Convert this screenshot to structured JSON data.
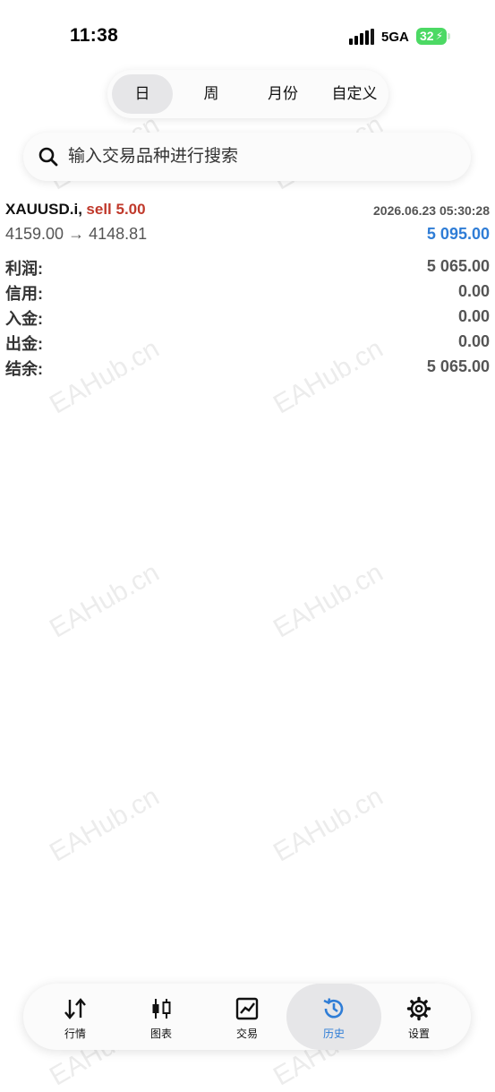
{
  "status_bar": {
    "time": "11:38",
    "network": "5GA",
    "battery": "32",
    "icons": [
      "signal-icon",
      "battery-icon"
    ]
  },
  "period_tabs": {
    "items": [
      "日",
      "周",
      "月份",
      "自定义"
    ],
    "active": "日"
  },
  "search": {
    "placeholder": "输入交易品种进行搜索",
    "icon": "search-icon"
  },
  "deal": {
    "symbol": "XAUUSD.i,",
    "side": "sell 5.00",
    "time": "2026.06.23 05:30:28",
    "prices": "4159.00 → 4148.81",
    "profit": "5 095.00"
  },
  "summary": [
    {
      "label": "利润:",
      "value": "5 065.00"
    },
    {
      "label": "信用:",
      "value": "0.00"
    },
    {
      "label": "入金:",
      "value": "0.00"
    },
    {
      "label": "出金:",
      "value": "0.00"
    },
    {
      "label": "结余:",
      "value": "5 065.00"
    }
  ],
  "watermark": "EAHub.cn",
  "bottom_nav": {
    "items": [
      {
        "label": "行情",
        "icon": "quotes-arrows-icon"
      },
      {
        "label": "图表",
        "icon": "candlestick-chart-icon"
      },
      {
        "label": "交易",
        "icon": "trade-chart-icon"
      },
      {
        "label": "历史",
        "icon": "history-clock-icon"
      },
      {
        "label": "设置",
        "icon": "settings-gear-icon"
      }
    ],
    "active": "历史",
    "active_color": "#2f7dd6"
  },
  "colors": {
    "sell": "#c0392b",
    "profit": "#2f7dd6",
    "battery": "#4cd964"
  }
}
